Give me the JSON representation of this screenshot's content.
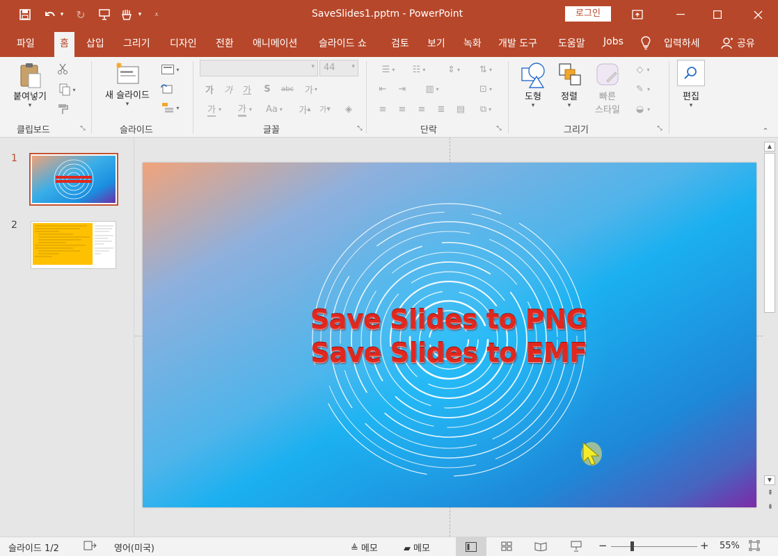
{
  "window": {
    "title": "SaveSlides1.pptm  -  PowerPoint",
    "login_label": "로그인"
  },
  "tabs": [
    {
      "label": "파일"
    },
    {
      "label": "홈"
    },
    {
      "label": "삽입"
    },
    {
      "label": "그리기"
    },
    {
      "label": "디자인"
    },
    {
      "label": "전환"
    },
    {
      "label": "애니메이션"
    },
    {
      "label": "슬라이드 쇼"
    },
    {
      "label": "검토"
    },
    {
      "label": "보기"
    },
    {
      "label": "녹화"
    },
    {
      "label": "개발 도구"
    },
    {
      "label": "도움말"
    },
    {
      "label": "Jobs"
    }
  ],
  "tell_me": "입력하세",
  "share": "공유",
  "ribbon": {
    "clipboard": {
      "paste": "붙여넣기",
      "group": "클립보드"
    },
    "slides": {
      "new_slide": "새 슬라이드",
      "group": "슬라이드"
    },
    "font": {
      "size": "44",
      "group": "글꼴",
      "bold": "가",
      "italic": "가",
      "underline": "가",
      "shadow": "S",
      "spacing": "가",
      "case": "Aa",
      "grow": "가",
      "shrink": "가",
      "highlight": "가",
      "color": "가"
    },
    "paragraph": {
      "group": "단락"
    },
    "drawing": {
      "shapes": "도형",
      "arrange": "정렬",
      "quick_styles_1": "빠른",
      "quick_styles_2": "스타일",
      "group": "그리기"
    },
    "editing": {
      "label": "편집"
    }
  },
  "thumbnails": [
    {
      "number": "1",
      "selected": true
    },
    {
      "number": "2",
      "selected": false
    }
  ],
  "slide": {
    "line1": "Save Slides to PNG",
    "line2": "Save Slides to EMF"
  },
  "status": {
    "slide_count": "슬라이드 1/2",
    "language": "영어(미국)",
    "notes": "메모",
    "comments": "메모",
    "zoom": "55%",
    "zoom_fraction": 0.55
  },
  "colors": {
    "accent": "#b7472a",
    "ribbon_bg": "#f3f3f3",
    "slide_title": "#e0281f"
  }
}
